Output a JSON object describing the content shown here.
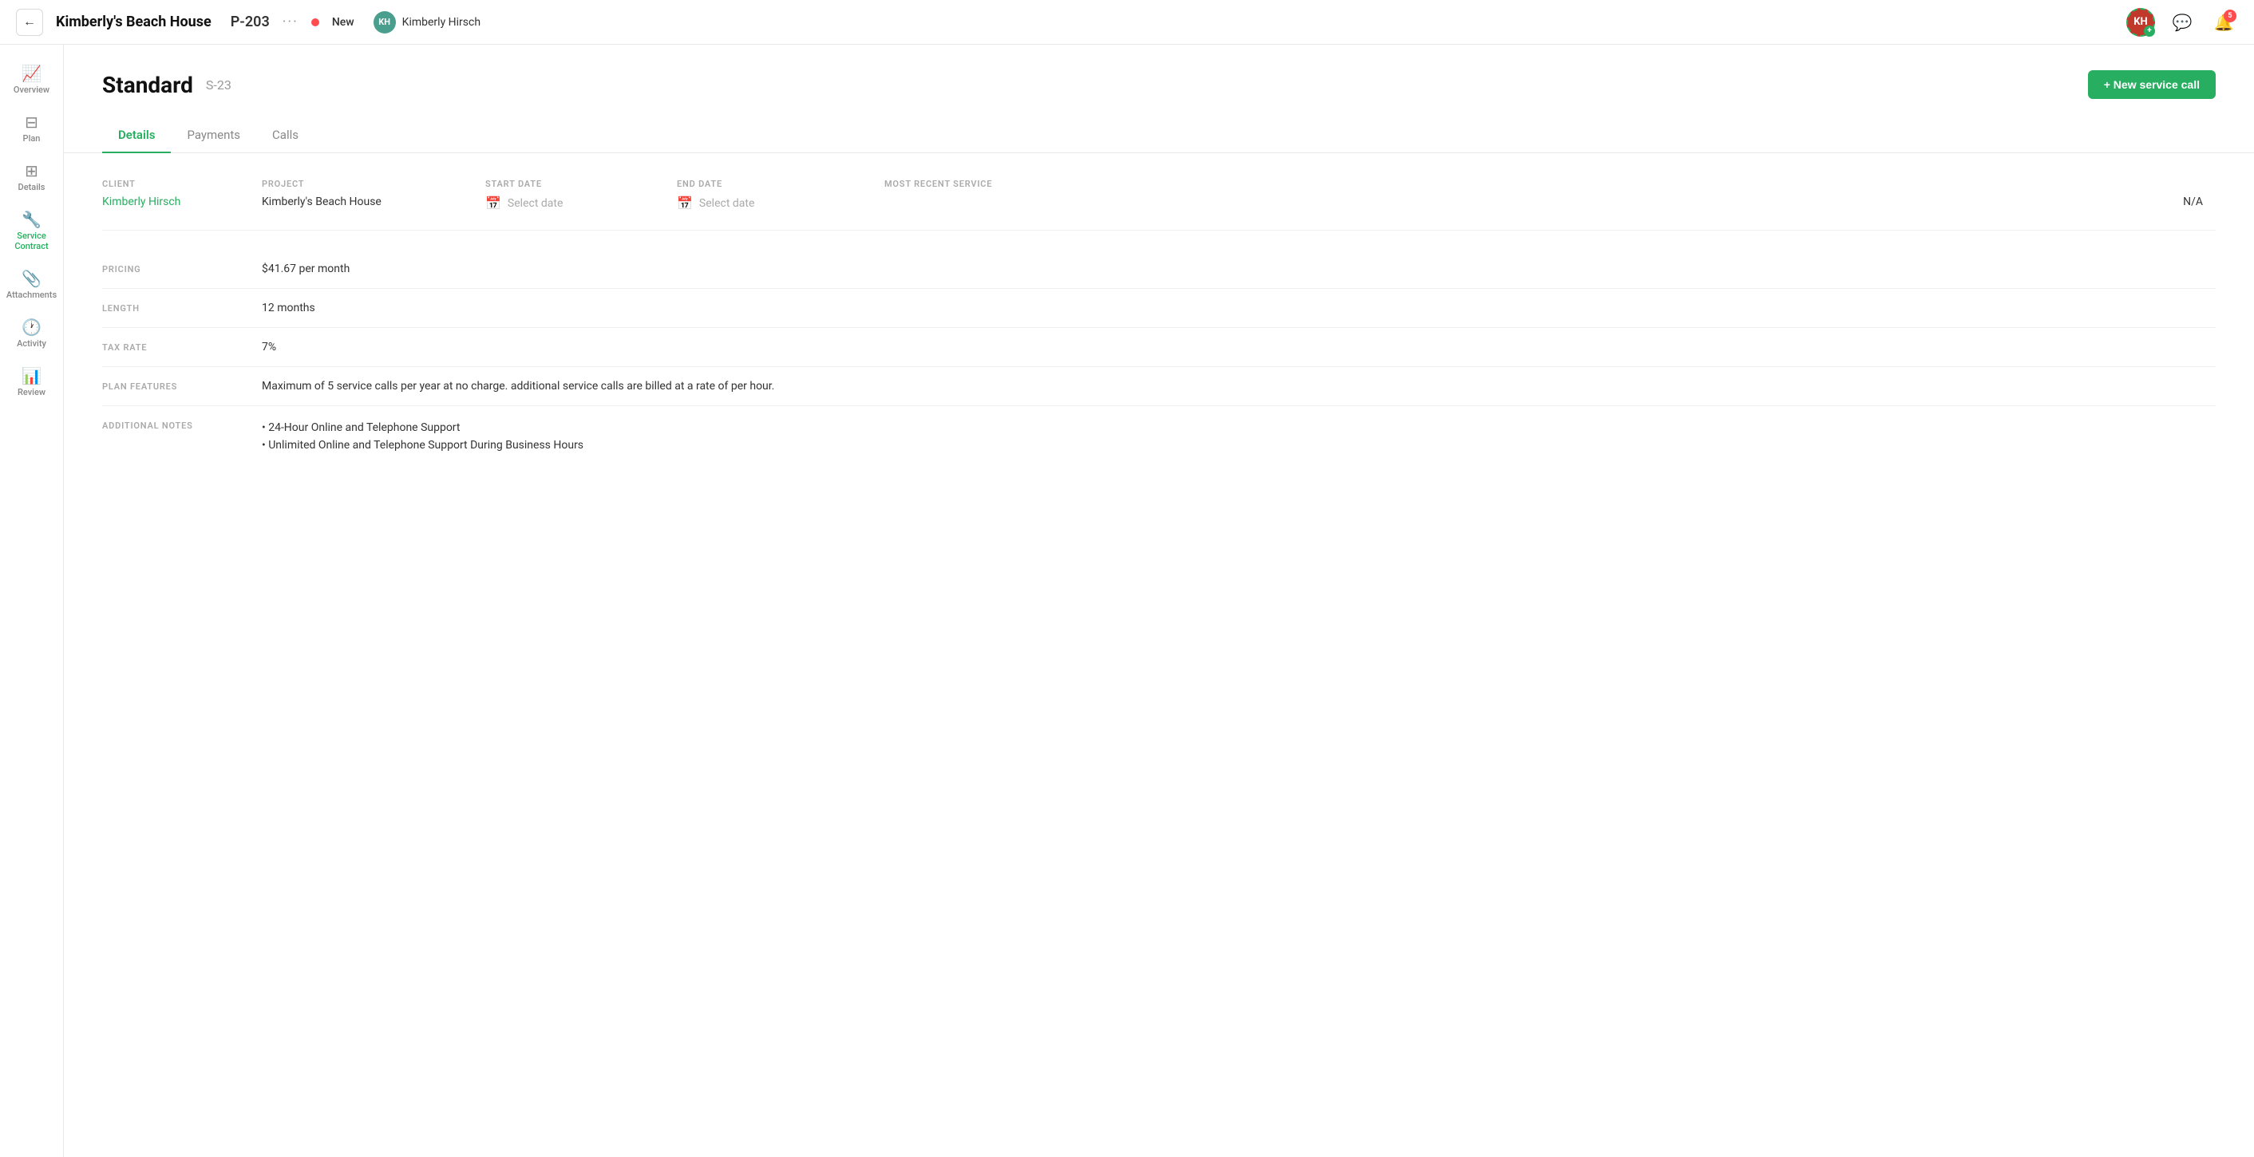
{
  "header": {
    "back_label": "←",
    "project_name": "Kimberly's Beach House",
    "project_id": "P-203",
    "more_dots": "···",
    "status_label": "New",
    "user_initials": "KH",
    "user_name": "Kimberly Hirsch",
    "avatar_initials": "KH",
    "notification_count": "5",
    "chat_icon": "💬",
    "bell_icon": "🔔"
  },
  "sidebar": {
    "items": [
      {
        "id": "overview",
        "label": "Overview",
        "icon": "📈",
        "active": false
      },
      {
        "id": "plan",
        "label": "Plan",
        "icon": "☰",
        "active": false
      },
      {
        "id": "details",
        "label": "Details",
        "icon": "⊞",
        "active": false
      },
      {
        "id": "service-contract",
        "label": "Service Contract",
        "icon": "🔧",
        "active": true
      },
      {
        "id": "attachments",
        "label": "Attachments",
        "icon": "📎",
        "active": false
      },
      {
        "id": "activity",
        "label": "Activity",
        "icon": "🕐",
        "active": false
      },
      {
        "id": "review",
        "label": "Review",
        "icon": "📊",
        "active": false
      }
    ]
  },
  "page": {
    "title": "Standard",
    "subtitle": "S-23",
    "new_service_call_label": "+ New service call"
  },
  "tabs": [
    {
      "id": "details",
      "label": "Details",
      "active": true
    },
    {
      "id": "payments",
      "label": "Payments",
      "active": false
    },
    {
      "id": "calls",
      "label": "Calls",
      "active": false
    }
  ],
  "details": {
    "client_label": "CLIENT",
    "client_value": "Kimberly Hirsch",
    "project_label": "PROJECT",
    "project_value": "Kimberly's Beach House",
    "start_date_label": "START DATE",
    "start_date_placeholder": "Select date",
    "end_date_label": "END DATE",
    "end_date_placeholder": "Select date",
    "most_recent_label": "MOST RECENT SERVICE",
    "most_recent_value": "N/A"
  },
  "pricing": {
    "label": "PRICING",
    "value": "$41.67 per month",
    "length_label": "LENGTH",
    "length_value": "12 months",
    "tax_label": "TAX RATE",
    "tax_value": "7%"
  },
  "plan_features": {
    "label": "PLAN FEATURES",
    "value": "Maximum of 5 service calls per year at no charge. additional service calls are billed at a rate of per hour."
  },
  "additional_notes": {
    "label": "ADDITIONAL NOTES",
    "notes": [
      "24-Hour Online and Telephone Support",
      "Unlimited Online and Telephone Support During Business Hours"
    ]
  }
}
